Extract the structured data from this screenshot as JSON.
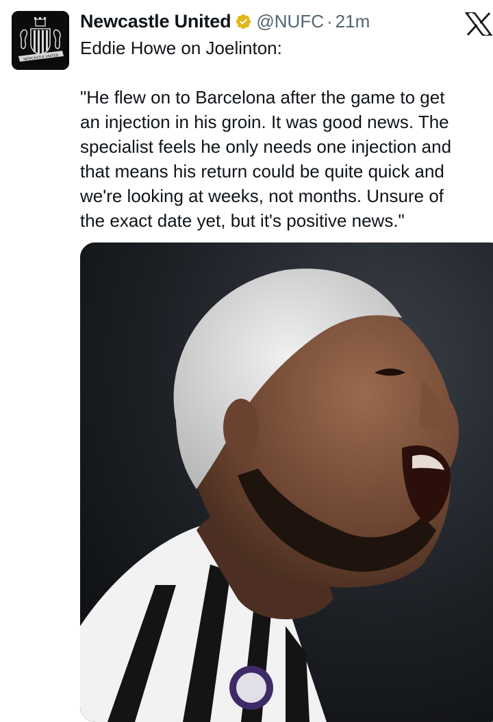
{
  "account": {
    "display_name": "Newcastle United",
    "handle": "@NUFC",
    "separator": "·",
    "time": "21m",
    "avatar_icon": "newcastle-crest-icon",
    "avatar_text": "NEWCASTLE UNITED",
    "verified_badge_color": "#e2b719"
  },
  "brand": {
    "icon": "x-logo-icon"
  },
  "tweet": {
    "lines": [
      "Eddie Howe on Joelinton:",
      "",
      "\"He flew on to Barcelona after the game to get",
      "an injection in his groin. It was good news. The",
      "specialist feels he only needs one injection and",
      "that means his return could be quite quick and",
      "we're looking at weeks, not months. Unsure of",
      "the exact date yet, but it's positive news.\""
    ]
  },
  "media": {
    "type": "photo",
    "icon": "player-photo"
  }
}
